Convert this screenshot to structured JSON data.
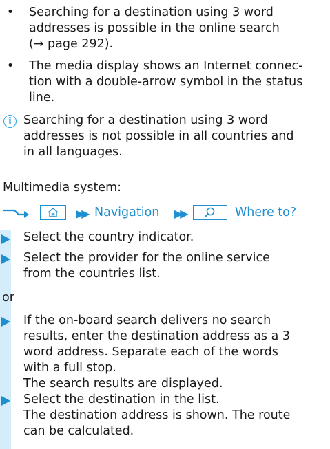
{
  "prerequisites": [
    {
      "line1": "Searching for a destination using 3 word",
      "line2": "addresses is possible in the online search",
      "line3": "(→ page 292)."
    },
    {
      "line1": "The media display shows an Internet connec-",
      "line2": "tion with a double-arrow symbol in the status",
      "line3": "line."
    }
  ],
  "note": {
    "line1": "Searching for a destination using 3 word",
    "line2": "addresses is not possible in all countries and",
    "line3": "in all languages."
  },
  "system_label": "Multimedia system:",
  "path": {
    "item1": "Navigation",
    "item2": "Where to?"
  },
  "steps_a": [
    {
      "lines": [
        "Select the country indicator."
      ]
    },
    {
      "lines": [
        "Select the provider for the online service",
        "from the countries list."
      ]
    }
  ],
  "or_label": "or",
  "steps_b": [
    {
      "lines": [
        "If the on-board search delivers no search",
        "results, enter the destination address as a 3",
        "word address. Separate each of the words",
        "with a full stop.",
        "The search results are displayed."
      ]
    },
    {
      "lines": [
        "Select the destination in the list.",
        "The destination address is shown. The route",
        "can be calculated."
      ]
    }
  ],
  "colors": {
    "accent": "#1e8fd0",
    "bar": "#d5ecfa",
    "info": "#29a9e0"
  }
}
